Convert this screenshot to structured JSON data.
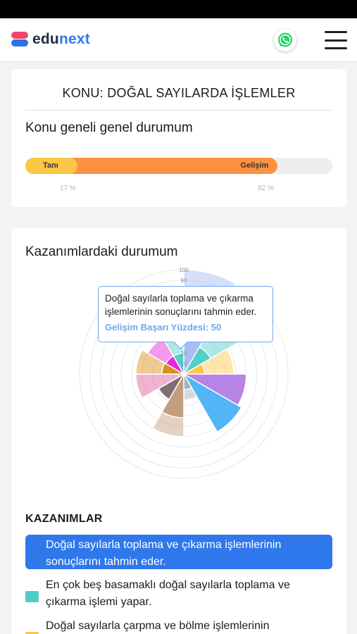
{
  "header": {
    "logo_part1": "edu",
    "logo_part2": "next",
    "whatsapp_icon": "whatsapp-icon",
    "menu_icon": "hamburger-menu-icon"
  },
  "topic": {
    "title": "KONU: DOĞAL SAYILARDA İŞLEMLER",
    "overall_heading": "Konu geneli genel durumum",
    "progress": {
      "tani_label": "Tanı",
      "gelisim_label": "Gelişim",
      "tani_value": 17,
      "gelisim_value": 82,
      "tani_text": "17 %",
      "gelisim_text": "82 %",
      "tani_color": "#fcc746",
      "gelisim_color": "#ff9142"
    }
  },
  "kazanim_section": {
    "heading": "Kazanımlardaki durumum",
    "chart_data": {
      "type": "polar-area",
      "radial_ticks": [
        "100",
        "90",
        "20",
        "10"
      ],
      "rmax": 100,
      "sectors": [
        {
          "color": "#a8b9f5",
          "tani": 100,
          "gelisim": 50
        },
        {
          "color": "#4ecdc4",
          "tani": 60,
          "gelisim": 30
        },
        {
          "color": "#fcc746",
          "tani": 48,
          "gelisim": 20
        },
        {
          "color": "#b57fe5",
          "tani": 60,
          "gelisim": 60
        },
        {
          "color": "#4db2f6",
          "tani": 64,
          "gelisim": 64
        },
        {
          "color": "#a6abb8",
          "tani": 25,
          "gelisim": 15
        },
        {
          "color": "#c09a7a",
          "tani": 60,
          "gelisim": 42
        },
        {
          "color": "#7a6c6c",
          "tani": 28,
          "gelisim": 28
        },
        {
          "color": "#e0579c",
          "tani": 46,
          "gelisim": 5
        },
        {
          "color": "#d98c14",
          "tani": 46,
          "gelisim": 21
        },
        {
          "color": "#ea1ed6",
          "tani": 40,
          "gelisim": 20
        },
        {
          "color": "#4ecdc4",
          "tani": 50,
          "gelisim": 20
        }
      ]
    },
    "tooltip": {
      "text": "Doğal sayılarla toplama ve çıkarma işlemlerinin sonuçlarını tahmin eder.",
      "value_text": "Gelişim Başarı Yüzdesi: 50"
    }
  },
  "kazanimlar": {
    "heading": "KAZANIMLAR",
    "items": [
      {
        "text": "Doğal sayılarla toplama ve çıkarma işlemlerinin sonuçlarını tahmin eder.",
        "color": "#2f78ec",
        "active": true
      },
      {
        "text": "En çok beş basamaklı doğal sayılarla toplama ve çıkarma işlemi yapar.",
        "color": "#4ecdc4",
        "active": false
      },
      {
        "text": "Doğal sayılarla çarpma ve bölme işlemlerinin",
        "color": "#fcc746",
        "active": false
      }
    ]
  }
}
